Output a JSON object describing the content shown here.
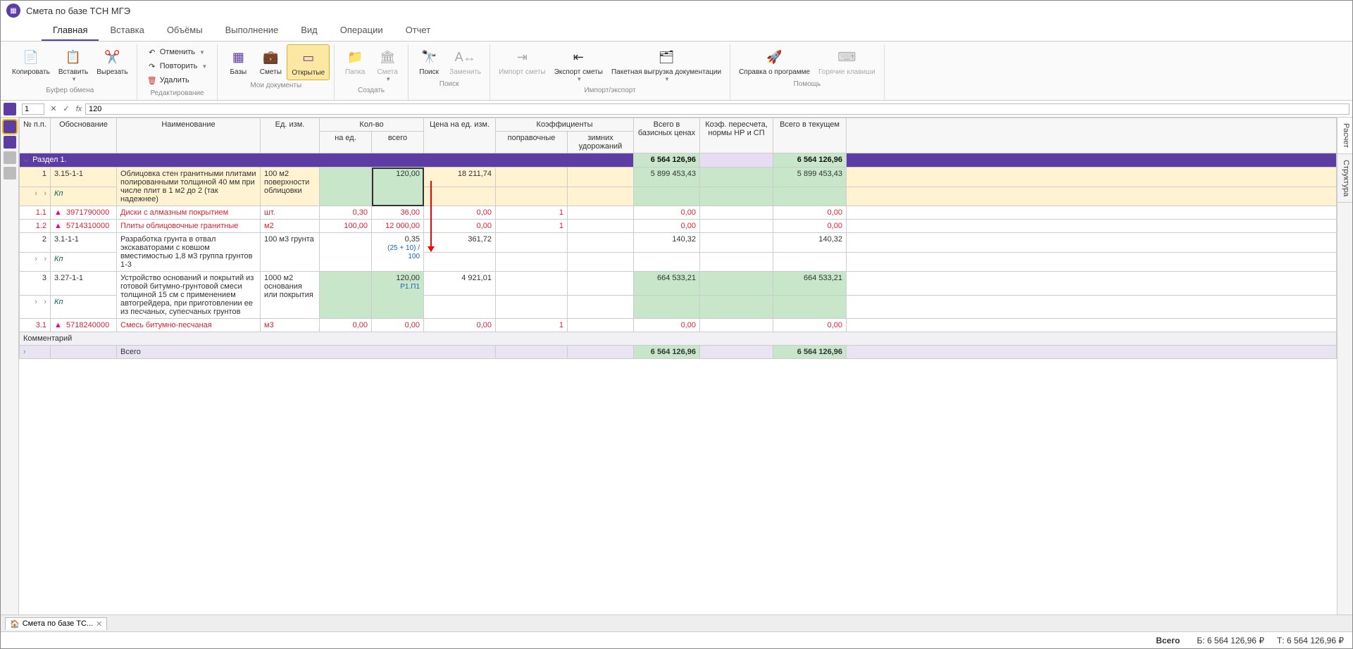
{
  "title": "Смета по базе ТСН МГЭ",
  "tabs": [
    "Главная",
    "Вставка",
    "Объёмы",
    "Выполнение",
    "Вид",
    "Операции",
    "Отчет"
  ],
  "active_tab": 0,
  "ribbon": {
    "clipboard": {
      "copy": "Копировать",
      "paste": "Вставить",
      "cut": "Вырезать",
      "group": "Буфер обмена"
    },
    "edit": {
      "undo": "Отменить",
      "redo": "Повторить",
      "delete": "Удалить",
      "group": "Редактирование"
    },
    "mydocs": {
      "bases": "Базы",
      "estimates": "Сметы",
      "open": "Открытые",
      "group": "Мои документы"
    },
    "create": {
      "folder": "Папка",
      "estimate": "Смета",
      "group": "Создать"
    },
    "search": {
      "find": "Поиск",
      "replace": "Заменить",
      "group": "Поиск"
    },
    "impexp": {
      "import": "Импорт сметы",
      "export": "Экспорт сметы",
      "batch": "Пакетная выгрузка документации",
      "group": "Импорт/экспорт"
    },
    "help": {
      "about": "Справка о программе",
      "hotkeys": "Горячие клавиши",
      "group": "Помощь"
    }
  },
  "fx": {
    "cell": "1",
    "value": "120"
  },
  "headers": {
    "npp": "№ п.п.",
    "osn": "Обоснование",
    "naim": "Наименование",
    "ed": "Ед. изм.",
    "kolvo": "Кол-во",
    "ked": "на ед.",
    "kvsego": "всего",
    "price": "Цена на ед. изм.",
    "koef": "Коэффициенты",
    "kpopr": "поправочные",
    "kzim": "зимних удорожаний",
    "bazis": "Всего в базисных ценах",
    "knr": "Коэф. пересчета, нормы НР и СП",
    "tek": "Всего в текущем"
  },
  "section": {
    "title": "Раздел 1.",
    "bazis": "6 564 126,96",
    "tek": "6 564 126,96"
  },
  "rows": [
    {
      "npp": "1",
      "osn": "3.15-1-1",
      "kn": "Кп",
      "naim": "Облицовка стен гранитными плитами полированными толщиной 40 мм при числе плит в 1 м2 до 2 (так надежнее)",
      "ed": "100 м2 поверхности облицовки",
      "kvsego": "120,00",
      "price": "18 211,74",
      "bazis": "5 899 453,43",
      "tek": "5 899 453,43"
    },
    {
      "npp": "1.1",
      "warn": true,
      "osn": "3971790000",
      "naim": "Диски с алмазным покрытием",
      "ed": "шт.",
      "ked": "0,30",
      "kvsego": "36,00",
      "price": "0,00",
      "kpopr": "1",
      "bazis": "0,00",
      "tek": "0,00"
    },
    {
      "npp": "1.2",
      "warn": true,
      "osn": "5714310000",
      "naim": "Плиты облицовочные гранитные",
      "ed": "м2",
      "ked": "100,00",
      "kvsego": "12 000,00",
      "price": "0,00",
      "kpopr": "1",
      "bazis": "0,00",
      "tek": "0,00"
    },
    {
      "npp": "2",
      "osn": "3.1-1-1",
      "kn": "Кп",
      "naim": "Разработка грунта в отвал экскаваторами с ковшом вместимостью 1,8 м3 группа грунтов 1-3",
      "ed": "100 м3 грунта",
      "kvsego": "0,35",
      "kvsego2": "(25 + 10) / 100",
      "price": "361,72",
      "bazis": "140,32",
      "tek": "140,32"
    },
    {
      "npp": "3",
      "osn": "3.27-1-1",
      "kn": "Кп",
      "naim": "Устройство оснований и покрытий из готовой битумно-грунтовой смеси толщиной 15 см с применением автогрейдера, при приготовлении ее из песчаных, супесчаных грунтов",
      "ed": "1000 м2 основания или покрытия",
      "kvsego": "120,00",
      "kvsego2": "Р1.П1",
      "price": "4 921,01",
      "bazis": "664 533,21",
      "tek": "664 533,21"
    },
    {
      "npp": "3.1",
      "warn": true,
      "osn": "5718240000",
      "naim": "Смесь битумно-песчаная",
      "ed": "м3",
      "ked": "0,00",
      "kvsego": "0,00",
      "price": "0,00",
      "kpopr": "1",
      "bazis": "0,00",
      "tek": "0,00"
    }
  ],
  "comment_label": "Комментарий",
  "total": {
    "label": "Всего",
    "bazis": "6 564 126,96",
    "tek": "6 564 126,96"
  },
  "right_tabs": [
    "Расчет",
    "Структура"
  ],
  "doctab": {
    "label": "Смета по базе ТС..."
  },
  "status": {
    "label": "Всего",
    "b": "Б: 6 564 126,96 ₽",
    "t": "Т: 6 564 126,96 ₽"
  }
}
